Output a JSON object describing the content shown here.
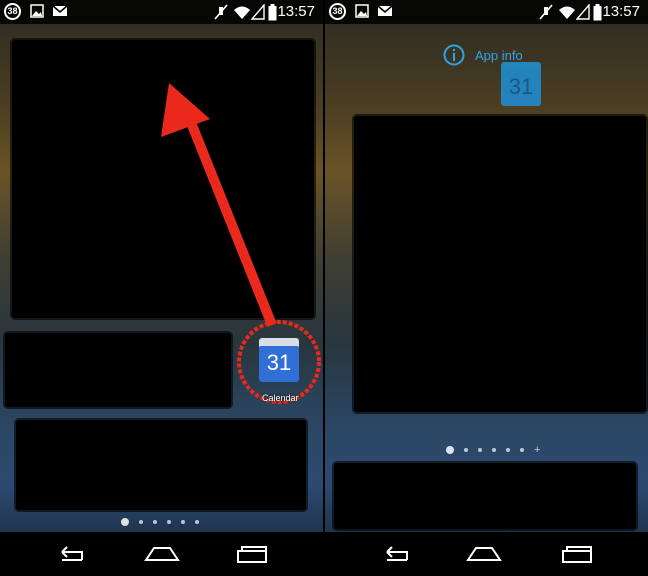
{
  "status_bar": {
    "badge": "38",
    "time": "13:57"
  },
  "left_screen": {
    "app_icon": {
      "date_number": "31",
      "label": "Calendar"
    },
    "page_indicator": {
      "pages": 6,
      "active_index": 0
    }
  },
  "right_screen": {
    "drop_target": {
      "label": "App info"
    },
    "dragged_icon": {
      "date_number": "31"
    },
    "page_indicator": {
      "pages": 6,
      "active_index": 0,
      "add_page": "+"
    }
  },
  "colors": {
    "annotation_red": "#e8291b",
    "app_info_blue": "#2fa3e8",
    "calendar_blue": "#2f6fd6"
  },
  "icons": [
    "notification-badge-icon",
    "gallery-icon",
    "gmail-icon",
    "mute-icon",
    "wifi-icon",
    "signal-icon",
    "battery-icon",
    "back-icon",
    "home-icon",
    "recents-icon",
    "info-icon",
    "calendar-app-icon"
  ]
}
